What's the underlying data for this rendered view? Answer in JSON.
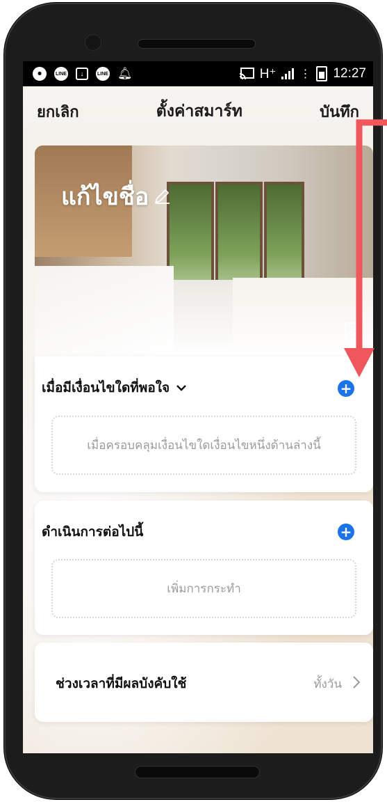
{
  "status_bar": {
    "left_icons": [
      "aperture-icon",
      "line-app-icon",
      "download-icon",
      "line-app-icon",
      "notification-bell-icon"
    ],
    "line_label": "LINE",
    "network": "H⁺",
    "time": "12:27"
  },
  "header": {
    "cancel_label": "ยกเลิก",
    "title": "ตั้งค่าสมาร์ท",
    "save_label": "บันทึก"
  },
  "hero": {
    "edit_name_label": "แก้ไขชื่อ"
  },
  "conditions": {
    "title": "เมื่อมีเงื่อนไขใดที่พอใจ",
    "add_button": "+",
    "placeholder": "เมื่อครอบคลุมเงื่อนไขใดเงื่อนไขหนึ่งด้านล่างนี้"
  },
  "actions": {
    "title": "ดำเนินการต่อไปนี้",
    "add_button": "+",
    "placeholder": "เพิ่มการกระทำ"
  },
  "effective_period": {
    "label": "ช่วงเวลาที่มีผลบังคับใช้",
    "value": "ทั้งวัน"
  },
  "colors": {
    "accent_blue": "#1a73e8",
    "annotation_red": "#f0575c"
  }
}
